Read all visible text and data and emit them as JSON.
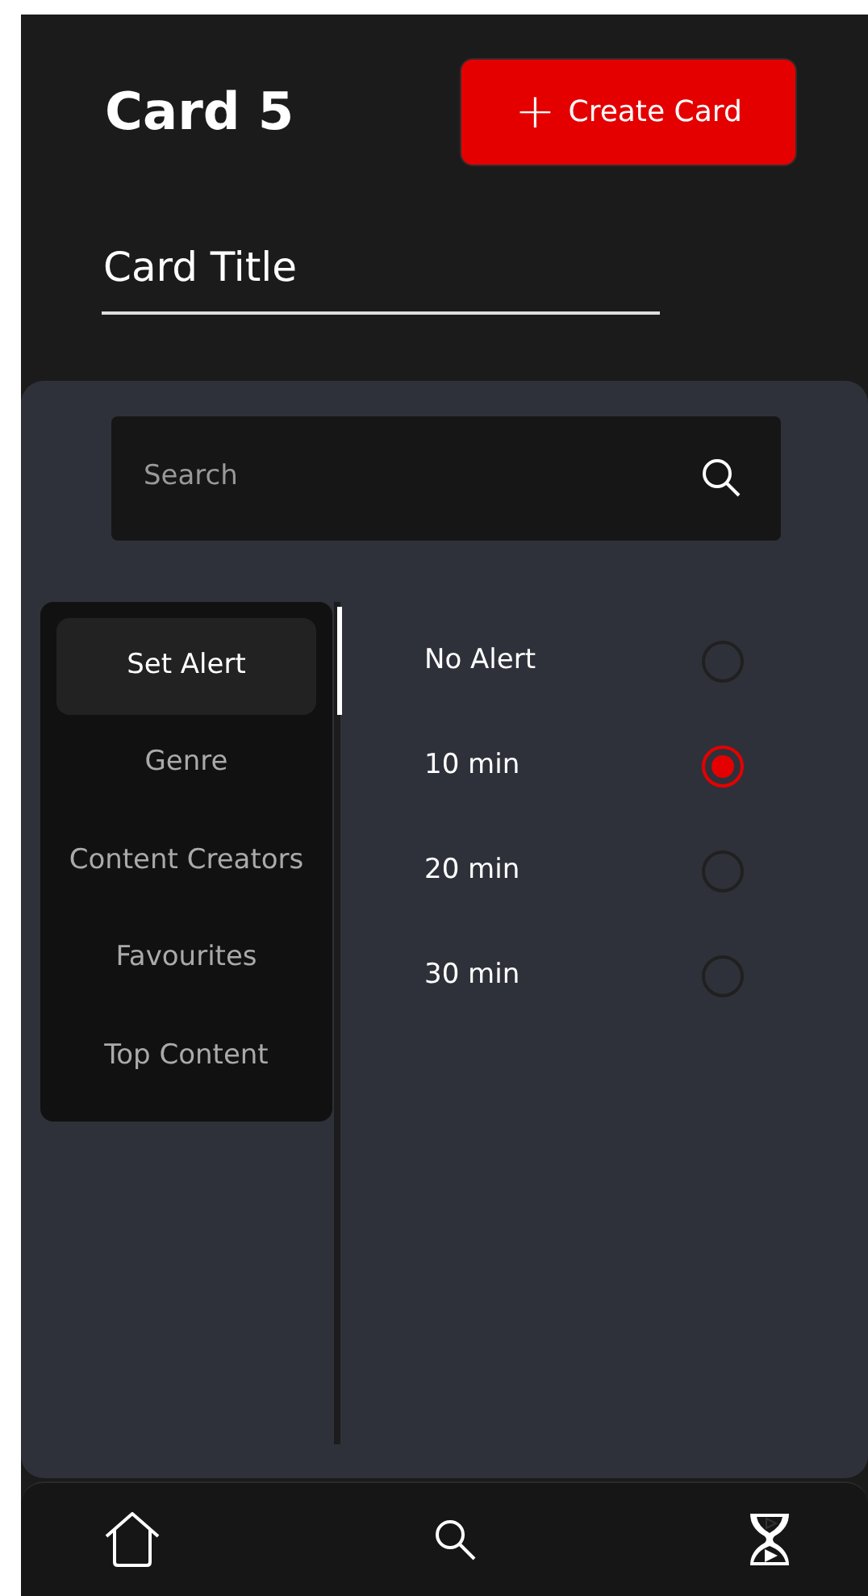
{
  "header": {
    "title": "Card 5",
    "button": {
      "icon": "+",
      "label": "Create Card"
    }
  },
  "card_title_field": {
    "value": "Card Title"
  },
  "search": {
    "placeholder": "Search"
  },
  "sidebar": {
    "items": [
      {
        "label": "Set Alert",
        "selected": true
      },
      {
        "label": "Genre",
        "selected": false
      },
      {
        "label": "Content Creators",
        "selected": false
      },
      {
        "label": "Favourites",
        "selected": false
      },
      {
        "label": "Top Content",
        "selected": false
      }
    ]
  },
  "alert_options": [
    {
      "label": "No Alert",
      "selected": false
    },
    {
      "label": "10 min",
      "selected": true
    },
    {
      "label": "20 min",
      "selected": false
    },
    {
      "label": "30 min",
      "selected": false
    }
  ]
}
